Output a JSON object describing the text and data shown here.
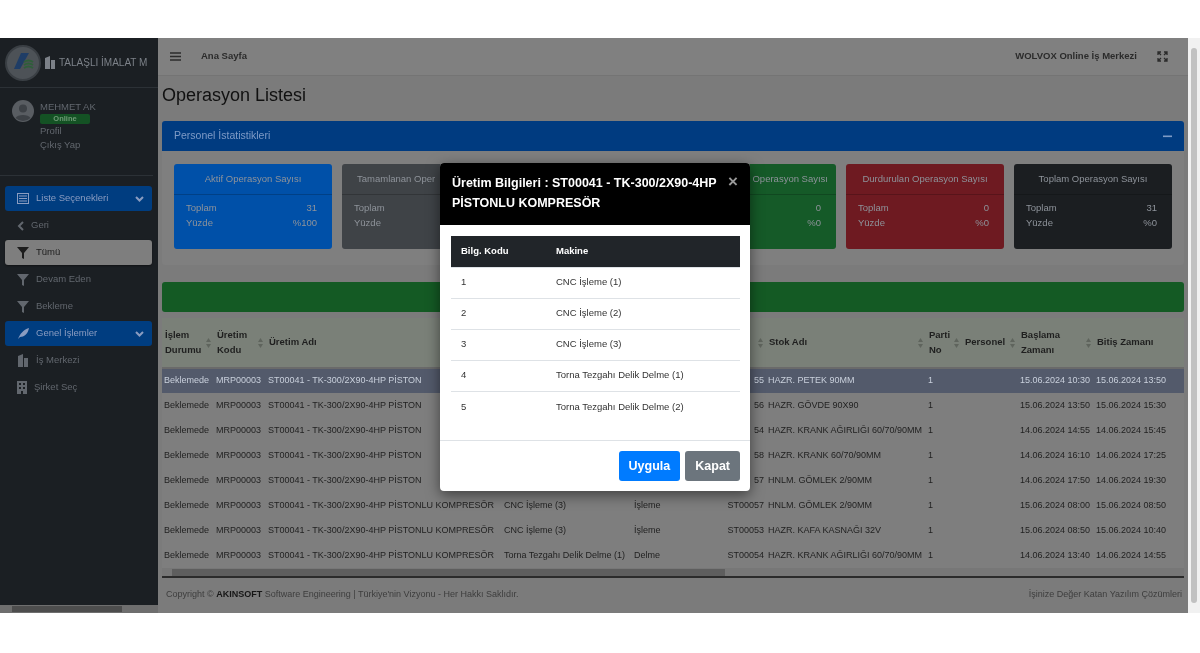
{
  "sidebar": {
    "brand": {
      "title": "TALAŞLI İMALAT M"
    },
    "user": {
      "name": "MEHMET AK",
      "status": "Online",
      "links": [
        "Profil",
        "Çıkış Yap"
      ]
    },
    "menu": [
      {
        "kind": "group",
        "label": "Liste Seçenekleri",
        "expanded": true
      },
      {
        "kind": "item",
        "label": "Geri",
        "selected": false
      },
      {
        "kind": "item",
        "label": "Tümü",
        "selected": true
      },
      {
        "kind": "item",
        "label": "Devam Eden",
        "selected": false
      },
      {
        "kind": "item",
        "label": "Bekleme",
        "selected": false
      },
      {
        "kind": "group",
        "label": "Genel İşlemler",
        "expanded": true
      },
      {
        "kind": "item",
        "label": "İş Merkezi",
        "selected": false
      },
      {
        "kind": "item",
        "label": "Şirket Seç",
        "selected": false
      }
    ]
  },
  "topbar": {
    "breadcrumb": "Ana Sayfa",
    "app_name": "WOLVOX Online İş Merkezi"
  },
  "page_title": "Operasyon Listesi",
  "stats_panel": {
    "title": "Personel İstatistikleri",
    "cards": [
      {
        "title": "Aktif Operasyon Sayısı",
        "color": "#0050a8",
        "rows": [
          {
            "label": "Toplam",
            "value": "31"
          },
          {
            "label": "Yüzde",
            "value": "%100"
          }
        ]
      },
      {
        "title": "Tamamlanan Oper",
        "color": "#3f4347",
        "rows": [
          {
            "label": "Toplam"
          },
          {
            "label": "Yüzde"
          }
        ]
      },
      {
        "title": "Operasyon Sayısı",
        "color": "#155a28",
        "rows": [
          {
            "value": "0"
          },
          {
            "value": "%0"
          }
        ]
      },
      {
        "title": "Durdurulan Operasyon Sayısı",
        "color": "#6e1a21",
        "rows": [
          {
            "label": "Toplam",
            "value": "0"
          },
          {
            "label": "Yüzde",
            "value": "%0"
          }
        ]
      },
      {
        "title": "Toplam Operasyon Sayısı",
        "color": "#1b1e21",
        "rows": [
          {
            "label": "Toplam",
            "value": "31"
          },
          {
            "label": "Yüzde",
            "value": "%0"
          }
        ]
      }
    ]
  },
  "table": {
    "columns": [
      {
        "label": "İşlem Durumu",
        "sortable": true
      },
      {
        "label": "Üretim Kodu",
        "sortable": true
      },
      {
        "label": "Üretim Adı",
        "sortable": false
      },
      {
        "sortable": true
      },
      {
        "label": "Stok Adı",
        "sortable": true
      },
      {
        "label": "Parti No",
        "sortable": true
      },
      {
        "label": "Personel",
        "sortable": true
      },
      {
        "label": "Başlama Zamanı",
        "sortable": true
      },
      {
        "label": "Bitiş Zamanı",
        "sortable": false
      }
    ],
    "rows": [
      {
        "selected": true,
        "status": "Beklemede",
        "code": "MRP00003",
        "name": "ST00041 - TK-300/2X90-4HP PİSTON",
        "column_6": "55",
        "stock_name": "HAZR. PETEK 90MM",
        "lot_no": "1",
        "start": "15.06.2024 10:30",
        "end": "15.06.2024 13:50"
      },
      {
        "selected": false,
        "status": "Beklemede",
        "code": "MRP00003",
        "name": "ST00041 - TK-300/2X90-4HP PİSTON",
        "column_6": "56",
        "stock_name": "HAZR. GÖVDE 90X90",
        "lot_no": "1",
        "start": "15.06.2024 13:50",
        "end": "15.06.2024 15:30"
      },
      {
        "selected": false,
        "status": "Beklemede",
        "code": "MRP00003",
        "name": "ST00041 - TK-300/2X90-4HP PİSTON",
        "column_6": "54",
        "stock_name": "HAZR. KRANK AĞIRLIĞI 60/70/90MM",
        "lot_no": "1",
        "start": "14.06.2024 14:55",
        "end": "14.06.2024 15:45"
      },
      {
        "selected": false,
        "status": "Beklemede",
        "code": "MRP00003",
        "name": "ST00041 - TK-300/2X90-4HP PİSTON",
        "column_6": "58",
        "stock_name": "HAZR. KRANK 60/70/90MM",
        "lot_no": "1",
        "start": "14.06.2024 16:10",
        "end": "14.06.2024 17:25"
      },
      {
        "selected": false,
        "status": "Beklemede",
        "code": "MRP00003",
        "name": "ST00041 - TK-300/2X90-4HP PİSTON",
        "column_6": "57",
        "stock_name": "HNLM. GÖMLEK 2/90MM",
        "lot_no": "1",
        "start": "14.06.2024 17:50",
        "end": "14.06.2024 19:30"
      },
      {
        "selected": false,
        "status": "Beklemede",
        "code": "MRP00003",
        "name": "ST00041 - TK-300/2X90-4HP PİSTONLU KOMPRESÖR",
        "column_4": "CNC İşleme (3)",
        "column_5": "İşleme",
        "column_6": "ST00057",
        "stock_name": "HNLM. GÖMLEK 2/90MM",
        "lot_no": "1",
        "start": "15.06.2024 08:00",
        "end": "15.06.2024 08:50"
      },
      {
        "selected": false,
        "status": "Beklemede",
        "code": "MRP00003",
        "name": "ST00041 - TK-300/2X90-4HP PİSTONLU KOMPRESÖR",
        "column_4": "CNC İşleme (3)",
        "column_5": "İşleme",
        "column_6": "ST00053",
        "stock_name": "HAZR. KAFA KASNAĞI 32V",
        "lot_no": "1",
        "start": "15.06.2024 08:50",
        "end": "15.06.2024 10:40"
      },
      {
        "selected": false,
        "status": "Beklemede",
        "code": "MRP00003",
        "name": "ST00041 - TK-300/2X90-4HP PİSTONLU KOMPRESÖR",
        "column_4": "Torna Tezgahı Delik Delme (1)",
        "column_5": "Delme",
        "column_6": "ST00054",
        "stock_name": "HAZR. KRANK AĞIRLIĞI 60/70/90MM",
        "lot_no": "1",
        "start": "14.06.2024 13:40",
        "end": "14.06.2024 14:55"
      }
    ]
  },
  "footer": {
    "copyright": "Copyright © **AKINSOFT** Software Engineering | Türkiye'nin Vizyonu - Her Hakkı Saklıdır.",
    "slogan": "İşinize Değer Katan Yazılım Çözümleri"
  },
  "dialog": {
    "title": "Üretim Bilgileri : ST00041 - TK-300/2X90-4HP PİSTONLU KOMPRESÖR",
    "close": "×",
    "table": {
      "columns": [
        "Bilg. Kodu",
        "Makine"
      ],
      "rows": [
        [
          "1",
          "CNC İşleme (1)"
        ],
        [
          "2",
          "CNC İşleme (2)"
        ],
        [
          "3",
          "CNC İşleme (3)"
        ],
        [
          "4",
          "Torna Tezgahı Delik Delme (1)"
        ],
        [
          "5",
          "Torna Tezgahı Delik Delme (2)"
        ]
      ]
    },
    "buttons": [
      {
        "label": "Uygula",
        "kind": "primary"
      },
      {
        "label": "Kapat",
        "kind": "secondary"
      }
    ]
  }
}
